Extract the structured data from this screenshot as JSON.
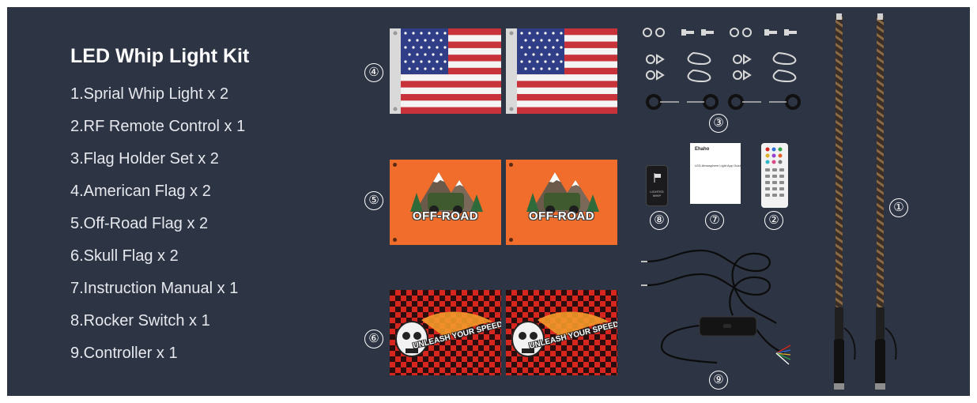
{
  "kit": {
    "title": "LED Whip Light Kit",
    "items": [
      "1.Sprial Whip Light x 2",
      "2.RF Remote Control x 1",
      "3.Flag Holder Set x 2",
      "4.American Flag x 2",
      "5.Off-Road Flag x 2",
      "6.Skull Flag x 2",
      "7.Instruction Manual x 1",
      "8.Rocker Switch x 1",
      "9.Controller x 1"
    ]
  },
  "callouts": {
    "n1": "①",
    "n2": "②",
    "n3": "③",
    "n4": "④",
    "n5": "⑤",
    "n6": "⑥",
    "n7": "⑦",
    "n8": "⑧",
    "n9": "⑨"
  },
  "flags": {
    "offroad_text": "OFF-ROAD",
    "skull_text": "UNLEASH YOUR SPEED"
  },
  "manual": {
    "brand": "Ehaho",
    "subtitle": "LED Atmosphere Light App Guide"
  },
  "rocker": {
    "label": "LIGHTED WHIP"
  },
  "colors": {
    "panel_bg": "#2d3443",
    "orange_flag": "#f06d2c",
    "skull_red": "#d7261e",
    "us_red": "#c8323a",
    "us_blue": "#2f3e86"
  }
}
